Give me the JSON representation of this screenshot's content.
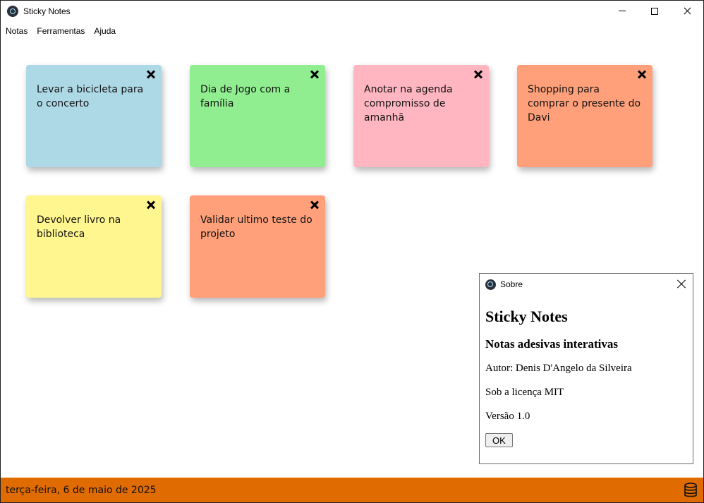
{
  "window": {
    "title": "Sticky Notes"
  },
  "menu": {
    "items": [
      "Notas",
      "Ferramentas",
      "Ajuda"
    ]
  },
  "notes": [
    {
      "text": "Levar a bicicleta para o concerto",
      "color": "#add8e6"
    },
    {
      "text": "Dia de Jogo com a família",
      "color": "#90ee90"
    },
    {
      "text": "Anotar na agenda compromisso de amanhã",
      "color": "#ffb6c1"
    },
    {
      "text": "Shopping para comprar o presente do Davi",
      "color": "#ffa07a"
    },
    {
      "text": "Devolver livro na biblioteca",
      "color": "#fff68f"
    },
    {
      "text": "Validar ultimo teste do projeto",
      "color": "#ffa07a"
    }
  ],
  "dialog": {
    "title": "Sobre",
    "heading": "Sticky Notes",
    "subheading": "Notas adesivas interativas",
    "author": "Autor: Denis D'Angelo da Silveira",
    "license": "Sob a licença MIT",
    "version": "Versão 1.0",
    "ok_label": "OK"
  },
  "status": {
    "date": "terça-feira, 6 de maio de 2025",
    "bar_color": "#e06b00"
  },
  "icons": {
    "app": "electron-logo-icon",
    "database": "database-icon",
    "note_close": "close-icon"
  }
}
